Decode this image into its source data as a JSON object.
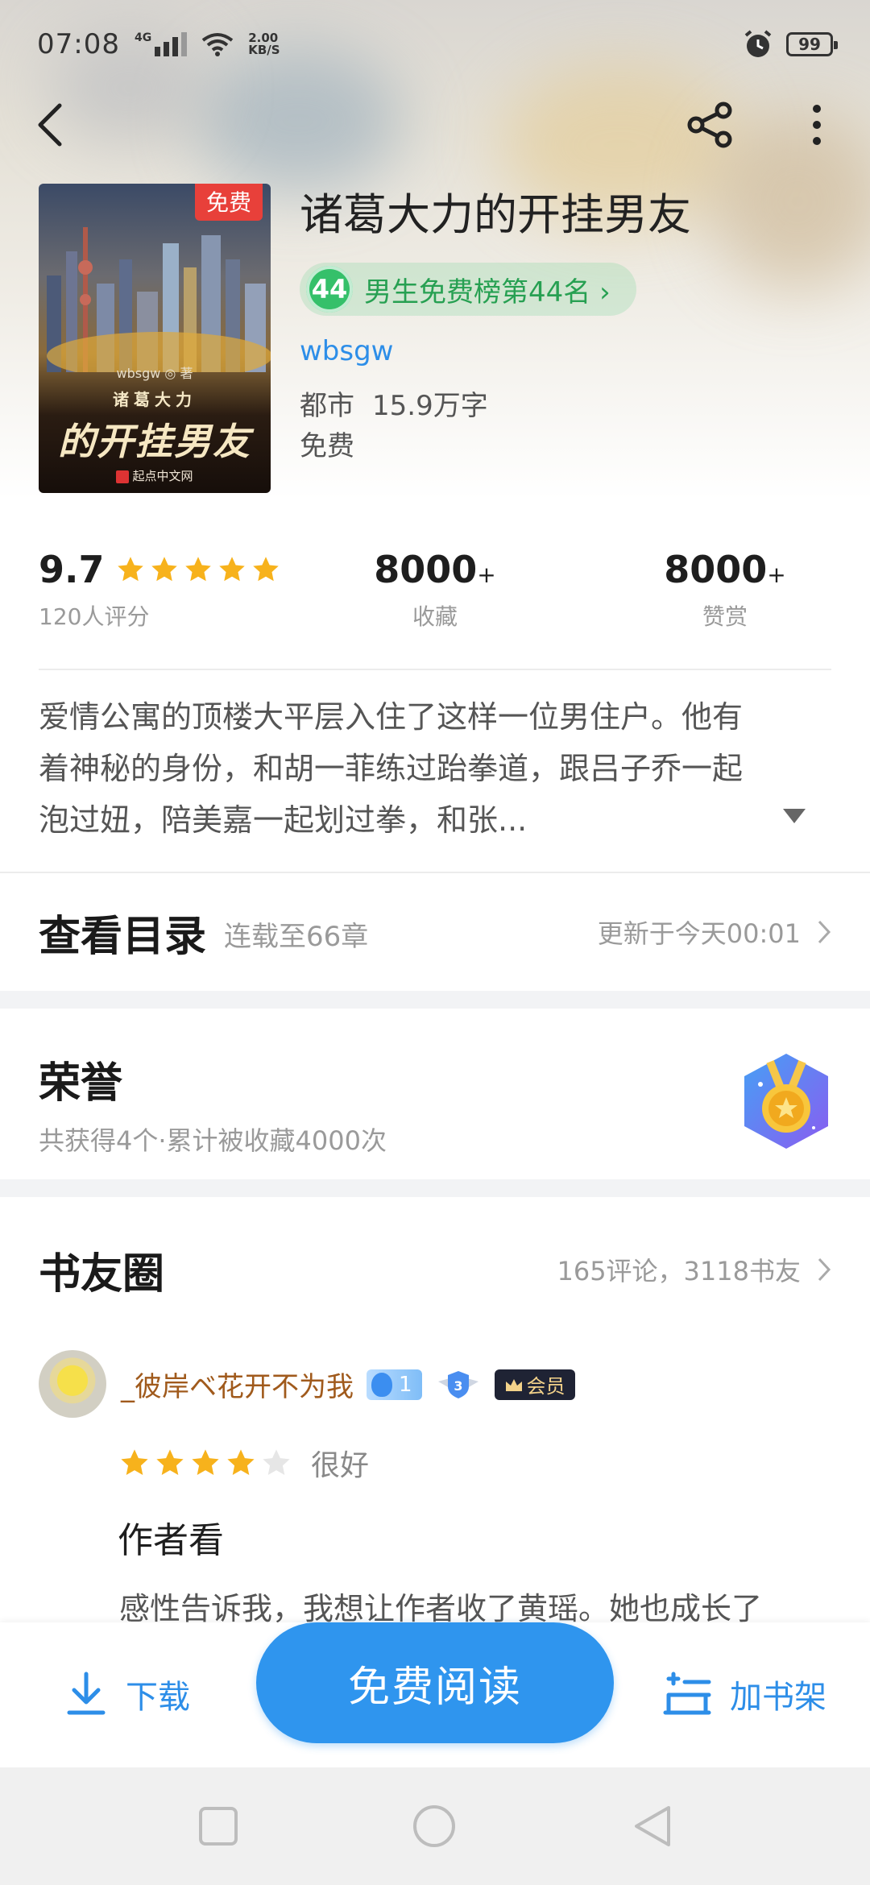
{
  "status_bar": {
    "time": "07:08",
    "network": "4G",
    "speed_value": "2.00",
    "speed_unit": "KB/S",
    "battery": "99"
  },
  "book": {
    "cover_badge": "免费",
    "cover_author": "wbsgw ◎ 著",
    "cover_subtitle": "诸葛大力",
    "cover_title": "的开挂男友",
    "cover_publisher": "起点中文网",
    "title": "诸葛大力的开挂男友",
    "rank_number": "44",
    "rank_text": "男生免费榜第44名 ›",
    "author": "wbsgw",
    "genre": "都市",
    "word_count": "15.9万字",
    "price": "免费"
  },
  "stats": {
    "score": "9.7",
    "stars": 5,
    "score_label": "120人评分",
    "collect_value": "8000",
    "collect_suffix": "+",
    "collect_label": "收藏",
    "like_value": "8000",
    "like_suffix": "+",
    "like_label": "赞赏"
  },
  "synopsis": {
    "line1": "爱情公寓的顶楼大平层入住了这样一位男住户。他有",
    "line2": "着神秘的身份，和胡一菲练过跆拳道，跟吕子乔一起",
    "line3": "泡过妞，陪美嘉一起划过拳，和张..."
  },
  "toc": {
    "title": "查看目录",
    "status": "连载至66章",
    "update": "更新于今天00:01"
  },
  "honor": {
    "title": "荣誉",
    "subtitle": "共获得4个·累计被收藏4000次"
  },
  "circle": {
    "title": "书友圈",
    "stats": "165评论，3118书友"
  },
  "comment": {
    "username": "_彼岸ベ花开不为我",
    "fan_level": "1",
    "user_level": "3",
    "vip_label": "会员",
    "rating": 4,
    "rating_text": "很好",
    "title": "作者看",
    "body": "感性告诉我，我想让作者收了黄瑶。她也成长了"
  },
  "bottom_bar": {
    "download": "下载",
    "read": "免费阅读",
    "add_shelf": "加书架"
  },
  "colors": {
    "accent": "#2f95ee",
    "link": "#2d8ee8",
    "rank_green": "#27a052",
    "star": "#f7b21c",
    "badge_red": "#e8403a"
  }
}
